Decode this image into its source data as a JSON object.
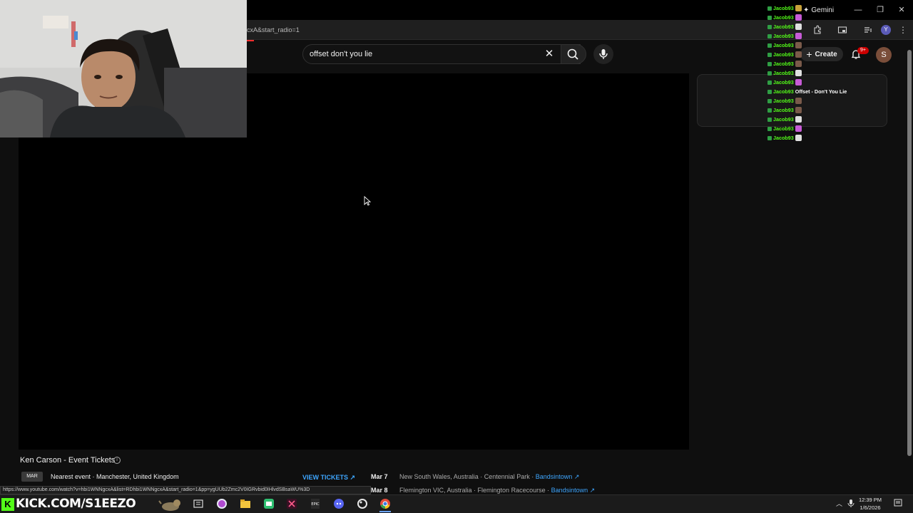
{
  "browser": {
    "url_fragment": "cxA&start_radio=1",
    "gemini_label": "Gemini",
    "profile_initial": "Y",
    "status_url": "https://www.youtube.com/watch?v=hbi1WNNgcxA&list=RDhbi1WNNgcxA&start_radio=1&pp=ygUUb2Zmc2V0IGRvbid0IHlvdSBsaWU%3D"
  },
  "youtube": {
    "search_value": "offset don't you lie",
    "create_label": "Create",
    "notification_count": "9+",
    "avatar_initial": "S"
  },
  "chat": {
    "lines": [
      {
        "user": "Jacob93",
        "msg": "",
        "emote": "#c9a23a"
      },
      {
        "user": "Jacob93",
        "msg": "",
        "emote": "#c75bd6"
      },
      {
        "user": "Jacob93",
        "msg": "",
        "emote": "#e0e0e0"
      },
      {
        "user": "Jacob93",
        "msg": "",
        "emote": "#c75bd6"
      },
      {
        "user": "Jacob93",
        "msg": "",
        "emote": "#7a5a4a"
      },
      {
        "user": "Jacob93",
        "msg": "",
        "emote": "#7a5a4a"
      },
      {
        "user": "Jacob93",
        "msg": "",
        "emote": "#7a5a4a"
      },
      {
        "user": "Jacob93",
        "msg": "",
        "emote": "#e0e0e0"
      },
      {
        "user": "Jacob93",
        "msg": "",
        "emote": "#c75bd6"
      },
      {
        "user": "Jacob93",
        "msg": "Offset - Don't You Lie",
        "emote": ""
      },
      {
        "user": "Jacob93",
        "msg": "",
        "emote": "#7a5a4a"
      },
      {
        "user": "Jacob93",
        "msg": "",
        "emote": "#7a5a4a"
      },
      {
        "user": "Jacob93",
        "msg": "",
        "emote": "#e0e0e0"
      },
      {
        "user": "Jacob93",
        "msg": "",
        "emote": "#c75bd6"
      },
      {
        "user": "Jacob93",
        "msg": "",
        "emote": "#e0e0e0"
      }
    ]
  },
  "events": {
    "title": "Ken Carson - Event Tickets",
    "month": "MAR",
    "nearest": "Nearest event · Manchester, United Kingdom",
    "view_tickets": "VIEW TICKETS ↗",
    "list": [
      {
        "date": "Mar 7",
        "venue": "New South Wales, Australia · Centennial Park",
        "link": "Bandsintown ↗"
      },
      {
        "date": "Mar 8",
        "venue": "Flemington VIC, Australia · Flemington Racecourse",
        "link": "Bandsintown ↗"
      }
    ]
  },
  "taskbar": {
    "kick_text": "KICK.COM/S1EEZO",
    "kick_letter": "K",
    "time": "12:39 PM",
    "date": "1/6/2026"
  },
  "colors": {
    "kick_green": "#53fc18",
    "link_blue": "#3ea6ff",
    "badge_red": "#cc0000"
  }
}
